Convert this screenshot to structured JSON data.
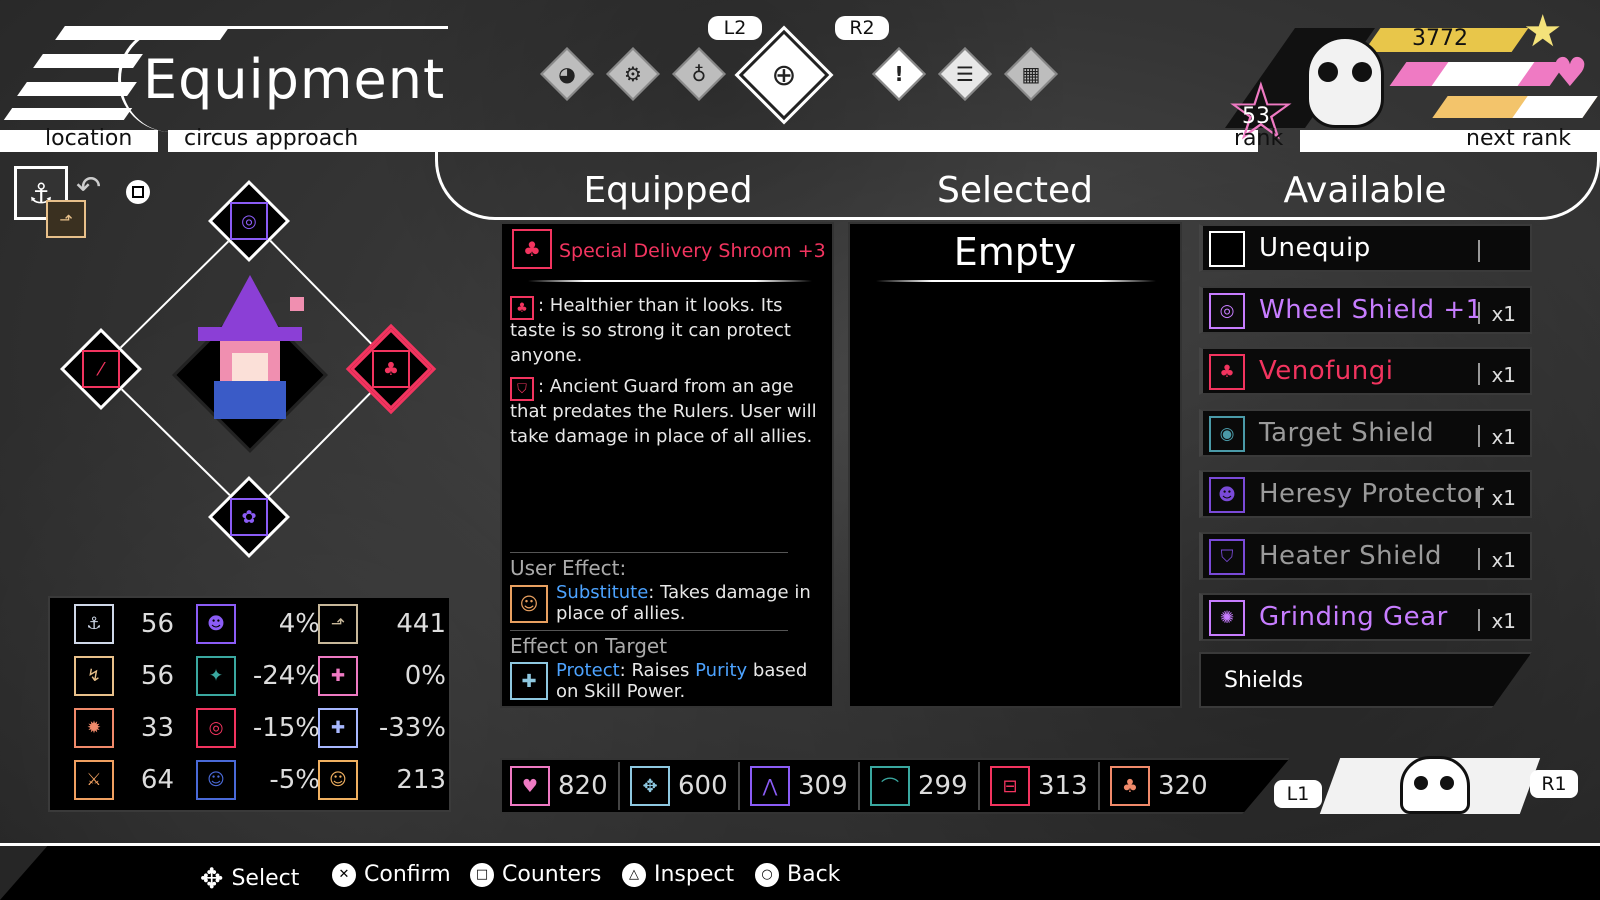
{
  "header": {
    "title": "Equipment",
    "location_label": "location",
    "location_value": "circus approach",
    "tab_left_trigger": "L2",
    "tab_right_trigger": "R2"
  },
  "tabs": [
    {
      "icon": "character-icon"
    },
    {
      "icon": "gear-icon"
    },
    {
      "icon": "bag-icon"
    },
    {
      "icon": "equipment-icon",
      "active": true
    },
    {
      "icon": "alert-icon"
    },
    {
      "icon": "notes-icon"
    },
    {
      "icon": "map-icon"
    }
  ],
  "player": {
    "points": "3772",
    "rank": "53",
    "rank_label": "rank",
    "next_rank_label": "next rank"
  },
  "columns": {
    "equipped": "Equipped",
    "selected": "Selected",
    "available": "Available"
  },
  "equipped_item": {
    "name": "Special Delivery Shroom +3",
    "desc1": ": Healthier than it looks. Its taste is so strong it can protect anyone.",
    "desc2": ": Ancient Guard from an age that predates the Rulers. User will take damage in place of all allies.",
    "user_effect_label": "User Effect:",
    "user_effect_name": "Substitute",
    "user_effect_text": ": Takes damage in place of allies.",
    "target_effect_label": "Effect on Target",
    "target_effect_name": "Protect",
    "target_effect_text_a": ": Raises ",
    "target_effect_keyword": "Purity",
    "target_effect_text_b": " based on Skill Power."
  },
  "selected_item": {
    "name": "Empty"
  },
  "available": [
    {
      "name": "Unequip",
      "qty": "",
      "color": "#ffffff"
    },
    {
      "name": "Wheel Shield +1",
      "qty": "x1",
      "color": "#c77dff"
    },
    {
      "name": "Venofungi",
      "qty": "x1",
      "color": "#f2345f"
    },
    {
      "name": "Target Shield",
      "qty": "x1",
      "color": "#9a9a9a"
    },
    {
      "name": "Heresy Protector",
      "qty": "x1",
      "color": "#9a9a9a"
    },
    {
      "name": "Heater Shield",
      "qty": "x1",
      "color": "#9a9a9a"
    },
    {
      "name": "Grinding Gear",
      "qty": "x1",
      "color": "#c77dff"
    }
  ],
  "category": "Shields",
  "stats": [
    [
      "56",
      "4%",
      "441"
    ],
    [
      "56",
      "-24%",
      "0%"
    ],
    [
      "33",
      "-15%",
      "-33%"
    ],
    [
      "64",
      "-5%",
      "213"
    ]
  ],
  "bottom_stats": [
    "820",
    "600",
    "309",
    "299",
    "313",
    "320"
  ],
  "switch_left": "L1",
  "switch_right": "R1",
  "footer": {
    "select": "Select",
    "confirm": "Confirm",
    "counters": "Counters",
    "inspect": "Inspect",
    "back": "Back"
  }
}
